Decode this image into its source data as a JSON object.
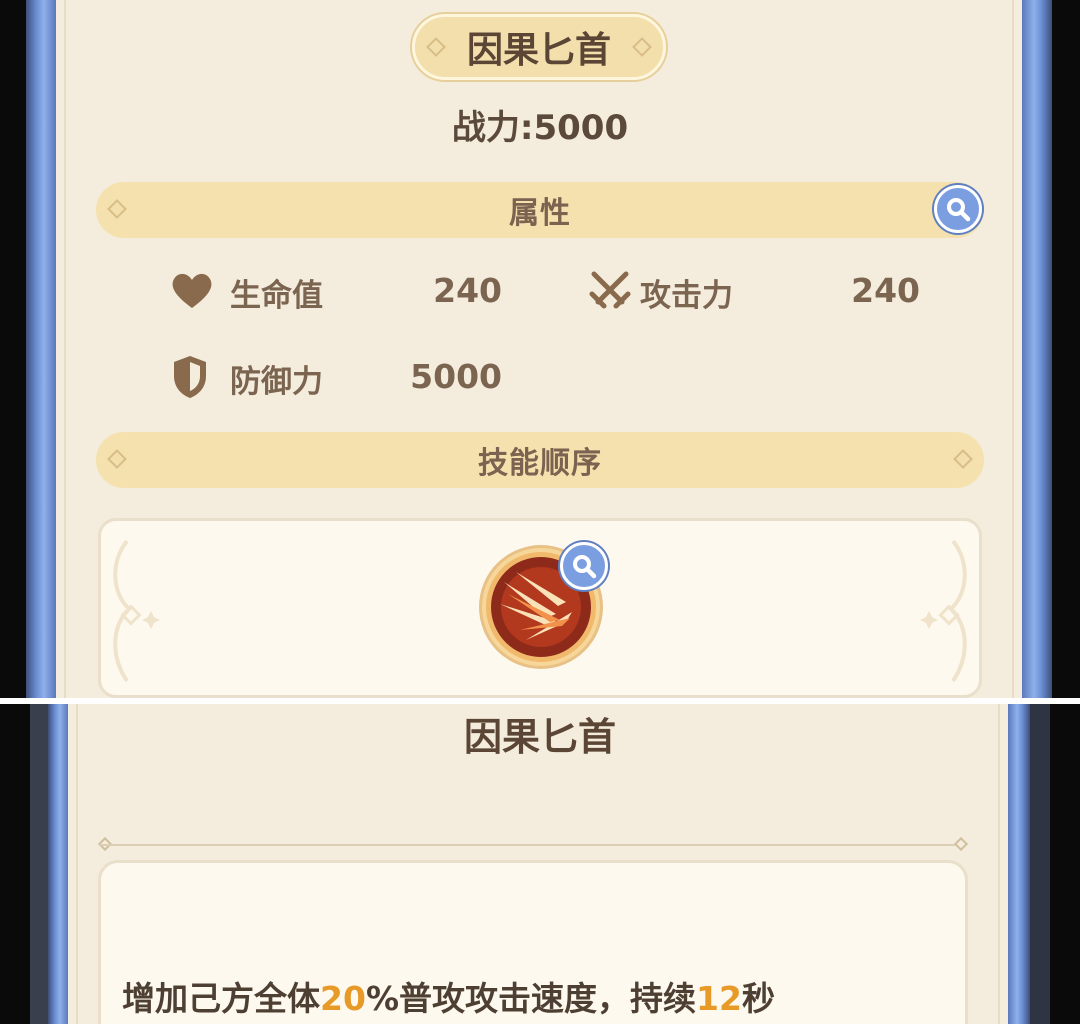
{
  "item": {
    "title": "因果匕首",
    "power": "战力:5000"
  },
  "sections": {
    "attributes_label": "属性",
    "skill_order_label": "技能顺序"
  },
  "stats": [
    {
      "label": "生命值",
      "value": "240",
      "icon": "heart-icon"
    },
    {
      "label": "攻击力",
      "value": "240",
      "icon": "crossed-swords-icon"
    },
    {
      "label": "防御力",
      "value": "5000",
      "icon": "shield-icon"
    }
  ],
  "skill": {
    "name": "因果匕首",
    "description": {
      "part1": "增加己方全体",
      "num1": "20",
      "part2": "%普攻攻击速度，持续",
      "num2": "12",
      "part3": "秒"
    }
  },
  "colors": {
    "frame_blue": "#6b8fd4",
    "card_bg": "#f4ecdc",
    "section_bar": "#f4e1ad",
    "text_brown": "#7b6450",
    "highlight_orange": "#e89a28",
    "magnify_blue": "#7b9ee0"
  }
}
